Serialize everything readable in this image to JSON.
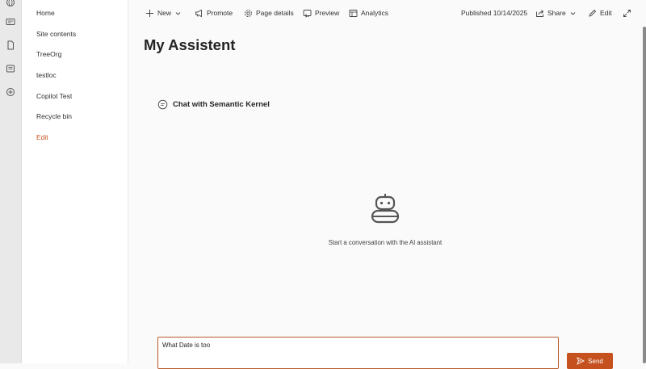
{
  "rail": {
    "icons": [
      "globe-icon",
      "card-icon",
      "document-icon",
      "news-icon",
      "add-circle-icon"
    ]
  },
  "sitenav": {
    "items": [
      {
        "label": "Home"
      },
      {
        "label": "Site contents"
      },
      {
        "label": "TreeOrg"
      },
      {
        "label": "testloc"
      },
      {
        "label": "Copilot Test"
      },
      {
        "label": "Recycle bin"
      }
    ],
    "edit_label": "Edit"
  },
  "toolbar": {
    "new_label": "New",
    "promote_label": "Promote",
    "page_details_label": "Page details",
    "preview_label": "Preview",
    "analytics_label": "Analytics",
    "published_label": "Published 10/14/2025",
    "share_label": "Share",
    "edit_label": "Edit"
  },
  "page": {
    "title": "My Assistent"
  },
  "chat": {
    "header": "Chat with Semantic Kernel",
    "empty_message": "Start a conversation with the AI assistant",
    "input_value": "What Date is too",
    "send_label": "Send"
  },
  "colors": {
    "accent": "#c4511e",
    "input_border": "#b85a2b",
    "rail_bg": "#e9e9e9",
    "page_bg": "#fafafa"
  }
}
